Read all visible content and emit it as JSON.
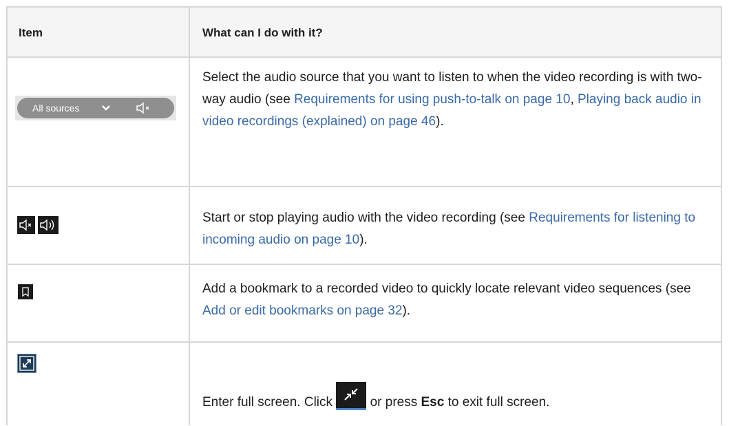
{
  "table": {
    "headers": {
      "item": "Item",
      "desc": "What can I do with it?"
    },
    "rows": [
      {
        "icon": "audio-source-selector",
        "pill_label": "All sources",
        "desc_part1": "Select the audio source that you want to listen to when the video recording is with two-way audio (see ",
        "link1": "Requirements for using push-to-talk on page 10",
        "desc_part2": ", ",
        "link2": "Playing back audio in video recordings (explained) on page 46",
        "desc_part3": ")."
      },
      {
        "icon": "mute-and-speaker-icons",
        "desc_part1": "Start or stop playing audio with the video recording (see ",
        "link1": "Requirements for listening to incoming audio on page 10",
        "desc_part2": ")."
      },
      {
        "icon": "bookmark-icon",
        "desc_part1": "Add a bookmark to a recorded video to quickly locate relevant video sequences (see ",
        "link1": "Add or edit bookmarks on page 32",
        "desc_part2": ")."
      },
      {
        "icon": "fullscreen-icon",
        "desc_part1": "Enter full screen. Click ",
        "desc_part2": " or press ",
        "key": "Esc",
        "desc_part3": " to exit full screen."
      }
    ]
  }
}
